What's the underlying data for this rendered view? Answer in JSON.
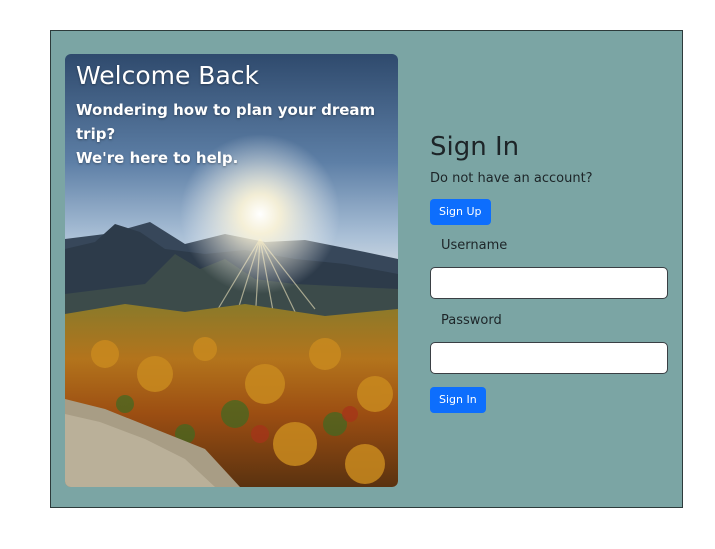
{
  "hero": {
    "title": "Welcome Back",
    "subtitle_line1": "Wondering how to plan your dream trip?",
    "subtitle_line2": "We're here to help.",
    "image": "mountain-sunrise-autumn-forest"
  },
  "form": {
    "title": "Sign In",
    "no_account_text": "Do not have an account?",
    "signup_label": "Sign Up",
    "username_label": "Username",
    "username_value": "",
    "password_label": "Password",
    "password_value": "",
    "signin_label": "Sign In"
  },
  "colors": {
    "page_bg": "#ffffff",
    "panel_bg": "#7ba5a4",
    "button_bg": "#0d6efd",
    "text_dark": "#1d2528"
  }
}
